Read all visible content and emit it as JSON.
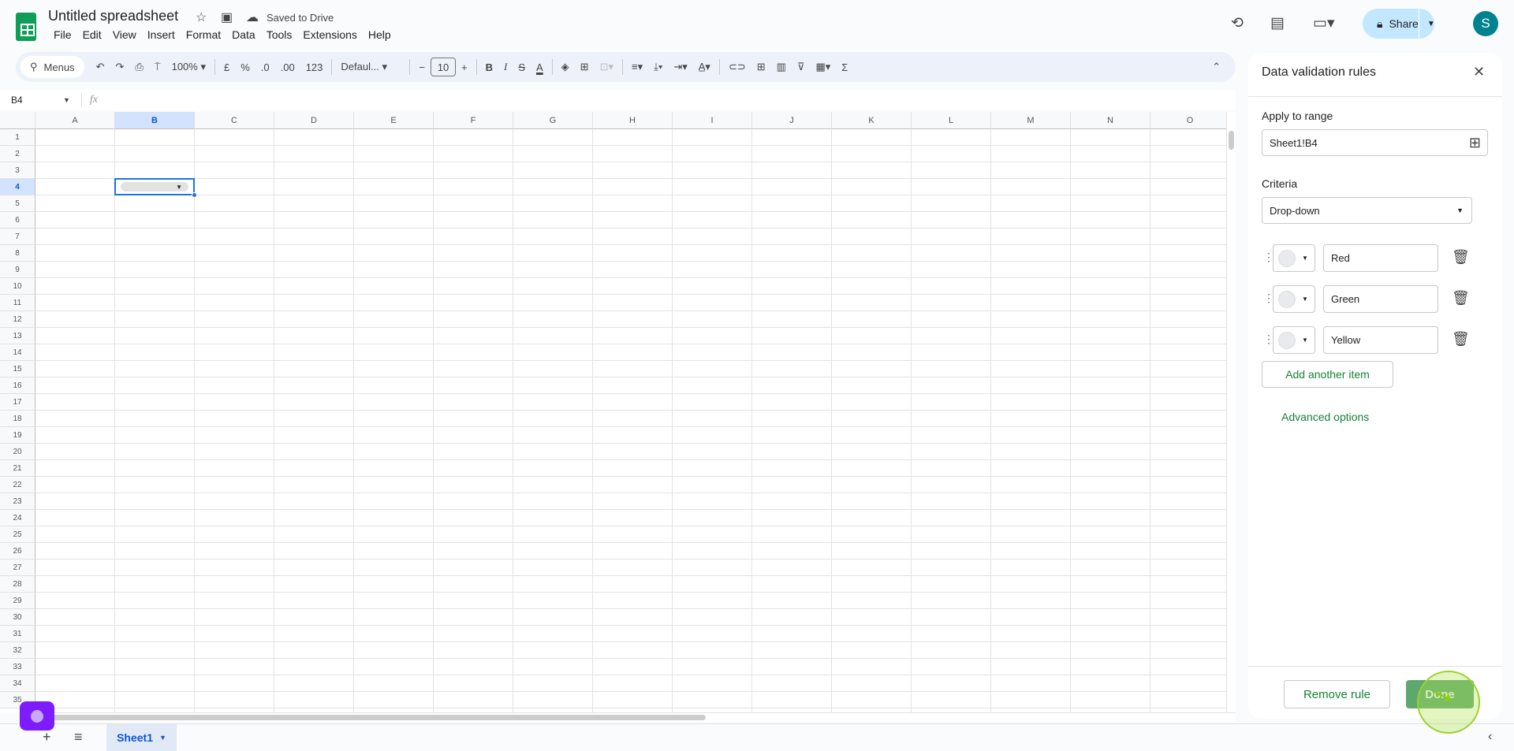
{
  "app": {
    "title": "Untitled spreadsheet",
    "save_status": "Saved to Drive",
    "share_label": "Share",
    "avatar_initial": "S",
    "logo_icon": "google-sheets-logo"
  },
  "menu": [
    "File",
    "Edit",
    "View",
    "Insert",
    "Format",
    "Data",
    "Tools",
    "Extensions",
    "Help"
  ],
  "toolbar": {
    "search_label": "Menus",
    "zoom": "100%",
    "currency": "£",
    "percent": "%",
    "dec_decrease": ".0",
    "dec_increase": ".00",
    "number_format": "123",
    "font": "Defaul...",
    "font_size": "10",
    "sum": "Σ"
  },
  "formula_bar": {
    "cell_ref": "B4",
    "fx": "fx",
    "value": ""
  },
  "grid": {
    "columns": [
      "A",
      "B",
      "C",
      "D",
      "E",
      "F",
      "G",
      "H",
      "I",
      "J",
      "K",
      "L",
      "M",
      "N",
      "O"
    ],
    "row_count": 35,
    "selected_cell": "B4",
    "selected_column": "B",
    "selected_row": 4
  },
  "panel": {
    "title": "Data validation rules",
    "apply_label": "Apply to range",
    "range_value": "Sheet1!B4",
    "criteria_label": "Criteria",
    "criteria_value": "Drop-down",
    "items": [
      {
        "value": "Red"
      },
      {
        "value": "Green"
      },
      {
        "value": "Yellow"
      }
    ],
    "add_item": "Add another item",
    "advanced": "Advanced options",
    "remove": "Remove rule",
    "done": "Done"
  },
  "sheets": {
    "tabs": [
      {
        "label": "Sheet1",
        "active": true
      }
    ]
  },
  "colors": {
    "accent_green": "#188038",
    "done_bg": "#5ea86e",
    "share_bg": "#c2e7ff",
    "selection": "#1a73e8",
    "avatar": "#00838f",
    "fab": "#7c1cff",
    "cursor_highlight": "#9bd22b"
  }
}
